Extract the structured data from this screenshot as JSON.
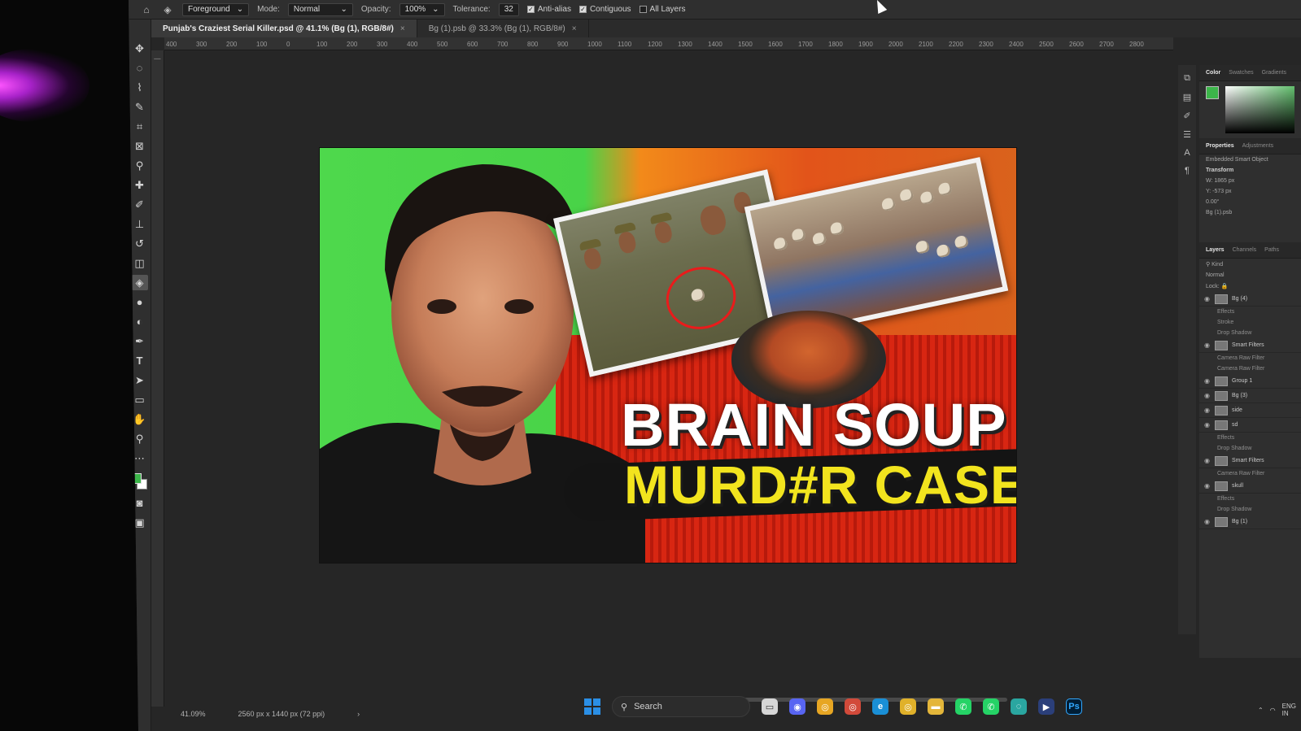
{
  "options_bar": {
    "tool_preset": "Foreground",
    "mode_label": "Mode:",
    "mode_value": "Normal",
    "opacity_label": "Opacity:",
    "opacity_value": "100%",
    "tolerance_label": "Tolerance:",
    "tolerance_value": "32",
    "anti_alias_label": "Anti-alias",
    "contiguous_label": "Contiguous",
    "all_layers_label": "All Layers"
  },
  "tabs": [
    {
      "label": "Punjab's Craziest Serial Killer.psd @ 41.1% (Bg (1), RGB/8#)",
      "active": true
    },
    {
      "label": "Bg (1).psb @ 33.3% (Bg (1), RGB/8#)",
      "active": false
    }
  ],
  "ruler_ticks": [
    "400",
    "300",
    "200",
    "100",
    "0",
    "100",
    "200",
    "300",
    "400",
    "500",
    "600",
    "700",
    "800",
    "900",
    "1000",
    "1100",
    "1200",
    "1300",
    "1400",
    "1500",
    "1600",
    "1700",
    "1800",
    "1900",
    "2000",
    "2100",
    "2200",
    "2300",
    "2400",
    "2500",
    "2600",
    "2700",
    "2800"
  ],
  "artwork": {
    "headline_line1": "BRAIN SOUP",
    "headline_line2": "MURD#R CASE"
  },
  "status": {
    "zoom": "41.09%",
    "doc_size": "2560 px x 1440 px (72 ppi)"
  },
  "panels": {
    "color_tabs": [
      "Color",
      "Swatches",
      "Gradients"
    ],
    "properties_tabs": [
      "Properties",
      "Adjustments"
    ],
    "properties_item": "Embedded Smart Object",
    "transform_label": "Transform",
    "width": "W: 1865 px",
    "height_y": "Y: -573 px",
    "angle": "0.00°",
    "source_file": "Bg (1).psb",
    "layers_tabs": [
      "Layers",
      "Channels",
      "Paths"
    ],
    "kind_label": "Kind",
    "blend_mode": "Normal",
    "lock_label": "Lock:",
    "layers": [
      {
        "name": "Bg (4)",
        "effects": [
          "Effects",
          "Stroke",
          "Drop Shadow"
        ]
      },
      {
        "name": "Smart Filters",
        "effects": [
          "Camera Raw Filter",
          "Camera Raw Filter"
        ]
      },
      {
        "name": "Group 1",
        "effects": []
      },
      {
        "name": "Bg (3)",
        "effects": []
      },
      {
        "name": "side",
        "effects": []
      },
      {
        "name": "sd",
        "effects": [
          "Effects",
          "Drop Shadow"
        ]
      },
      {
        "name": "Smart Filters",
        "effects": [
          "Camera Raw Filter"
        ]
      },
      {
        "name": "skull",
        "effects": [
          "Effects",
          "Drop Shadow"
        ]
      },
      {
        "name": "Bg (1)",
        "effects": []
      }
    ]
  },
  "taskbar": {
    "search_label": "Search",
    "apps": [
      "file-explorer",
      "discord",
      "chrome",
      "chrome-alt",
      "edge",
      "chrome-profile",
      "folder",
      "whatsapp",
      "whatsapp-business",
      "copilot",
      "media-player",
      "photoshop"
    ],
    "tray_language": "ENG",
    "tray_region": "IN"
  },
  "colors": {
    "foreground": "#3cb54a",
    "background": "#ffffff",
    "headline_white": "#ffffff",
    "headline_yellow": "#f2e41e"
  }
}
